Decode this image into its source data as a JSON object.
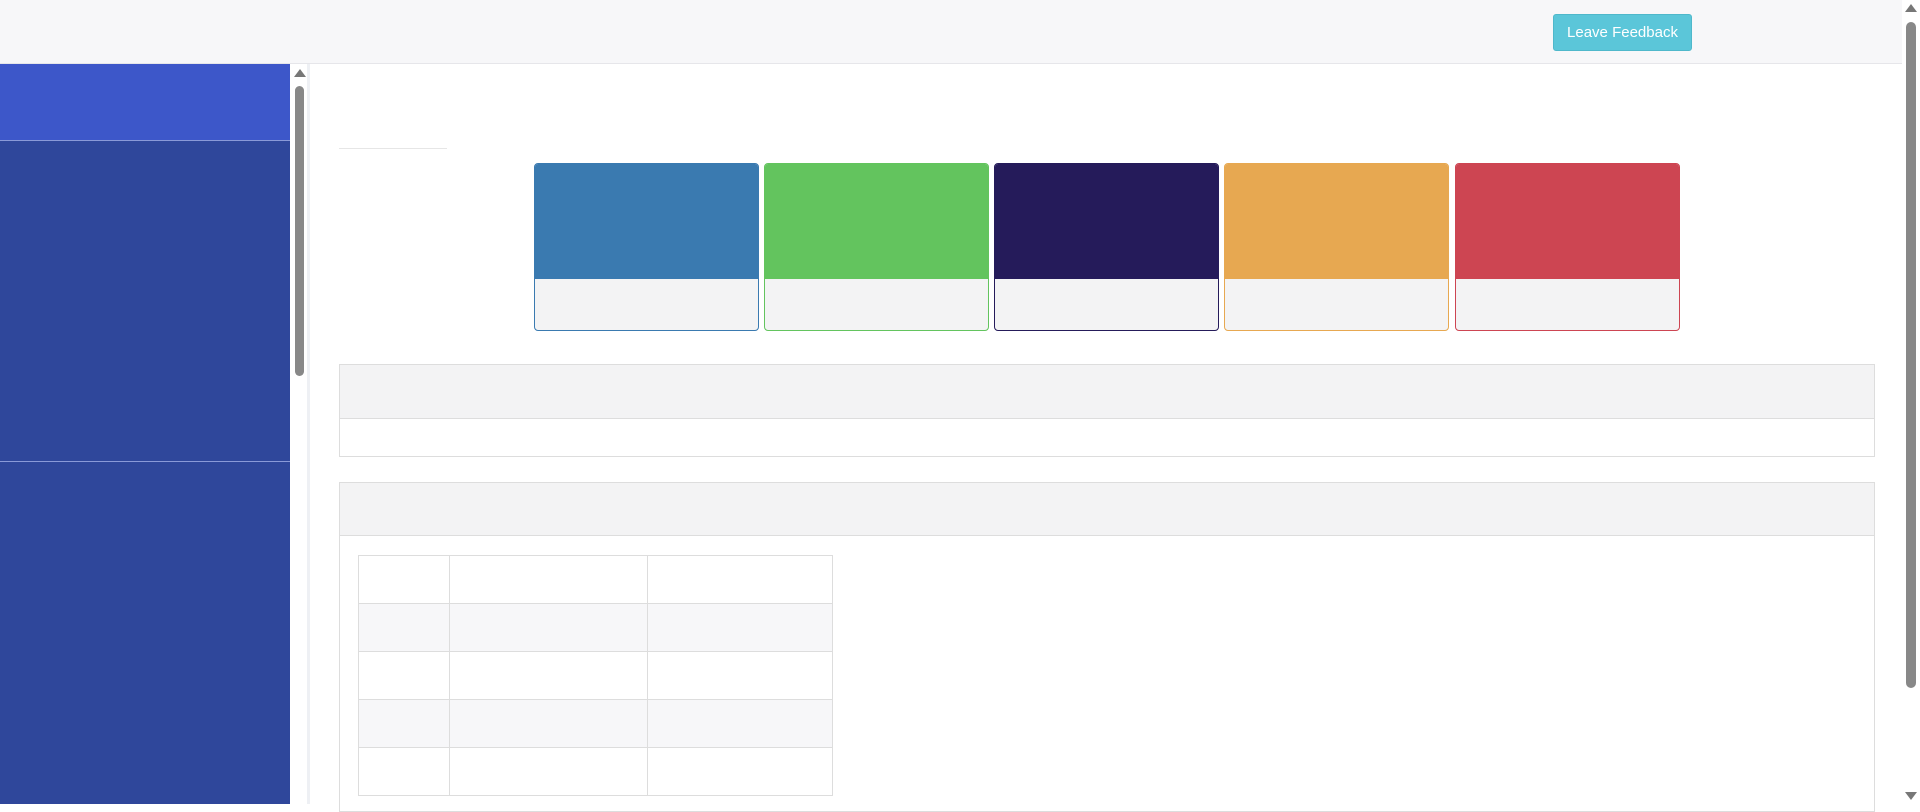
{
  "header": {
    "feedback_label": "Leave Feedback"
  },
  "stat_cards": [
    {
      "color": "#3a7ab0",
      "border": "#3a7ab0"
    },
    {
      "color": "#63c45e",
      "border": "#63c45e"
    },
    {
      "color": "#251b5a",
      "border": "#251b5a"
    },
    {
      "color": "#e7a851",
      "border": "#e7a851"
    },
    {
      "color": "#cd4552",
      "border": "#cd4552"
    }
  ]
}
